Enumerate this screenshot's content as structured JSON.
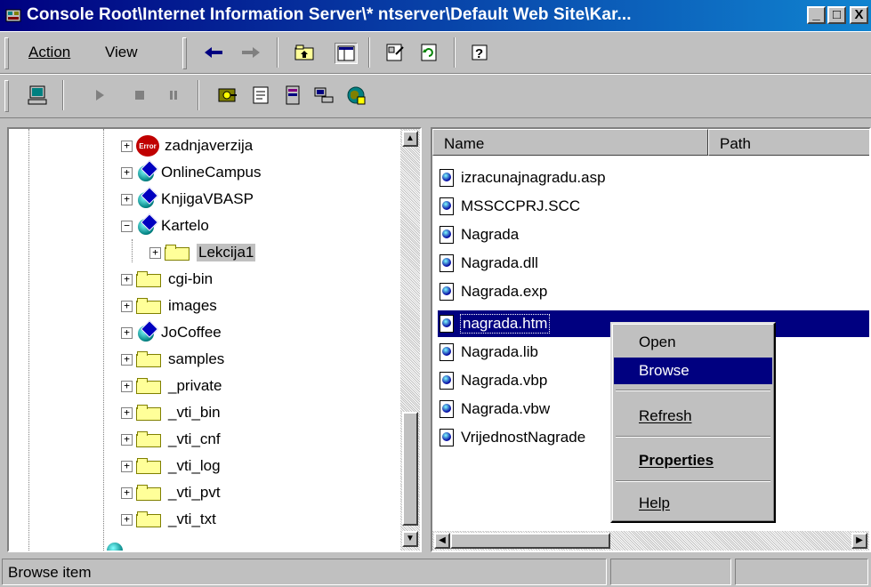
{
  "window": {
    "title": "Console Root\\Internet Information Server\\* ntserver\\Default Web Site\\Kar...",
    "minimize": "_",
    "maximize": "□",
    "close": "X"
  },
  "menubar": {
    "items": [
      {
        "label": "Action"
      },
      {
        "label": "View"
      }
    ]
  },
  "toolbar_icons": [
    "back-arrow-icon",
    "forward-arrow-icon",
    "up-folder-icon",
    "show-hide-tree-icon",
    "properties-icon",
    "refresh-icon",
    "help-icon"
  ],
  "actionbar_icons": [
    "computer-icon",
    "play-icon",
    "stop-icon",
    "pause-icon",
    "key-manager-icon",
    "document-icon",
    "server-icon",
    "network-icon",
    "globe-icon"
  ],
  "tree": {
    "items": [
      {
        "label": "zadnjaverzija",
        "icon": "error-icon",
        "badge": "Error"
      },
      {
        "label": "OnlineCampus",
        "icon": "web-app-icon"
      },
      {
        "label": "KnjigaVBASP",
        "icon": "web-app-icon"
      },
      {
        "label": "Kartelo",
        "icon": "web-app-icon"
      },
      {
        "label": "Lekcija1",
        "icon": "folder-icon"
      },
      {
        "label": "cgi-bin",
        "icon": "folder-icon"
      },
      {
        "label": "images",
        "icon": "folder-icon"
      },
      {
        "label": "JoCoffee",
        "icon": "web-app-icon"
      },
      {
        "label": "samples",
        "icon": "folder-icon"
      },
      {
        "label": "_private",
        "icon": "folder-icon"
      },
      {
        "label": "_vti_bin",
        "icon": "folder-icon"
      },
      {
        "label": "_vti_cnf",
        "icon": "folder-icon"
      },
      {
        "label": "_vti_log",
        "icon": "folder-icon"
      },
      {
        "label": "_vti_pvt",
        "icon": "folder-icon"
      },
      {
        "label": "_vti_txt",
        "icon": "folder-icon"
      }
    ]
  },
  "list": {
    "columns": [
      "Name",
      "Path"
    ],
    "items": [
      {
        "label": "izracunajnagradu.asp"
      },
      {
        "label": "MSSCCPRJ.SCC"
      },
      {
        "label": "Nagrada"
      },
      {
        "label": "Nagrada.dll"
      },
      {
        "label": "Nagrada.exp"
      },
      {
        "label": "nagrada.htm"
      },
      {
        "label": "Nagrada.lib"
      },
      {
        "label": "Nagrada.vbp"
      },
      {
        "label": "Nagrada.vbw"
      },
      {
        "label": "VrijednostNagrade"
      }
    ],
    "selected": "nagrada.htm"
  },
  "context_menu": {
    "items": [
      {
        "label": "Open"
      },
      {
        "label": "Browse"
      },
      {
        "label": "Refresh",
        "underline": "e"
      },
      {
        "label": "Properties",
        "underline": "P"
      },
      {
        "label": "Help",
        "underline": "H"
      }
    ],
    "highlighted": "Browse"
  },
  "statusbar": {
    "text": "Browse item"
  },
  "colors": {
    "title_bar": "#000080",
    "selection": "#000080",
    "face": "#c0c0c0"
  }
}
